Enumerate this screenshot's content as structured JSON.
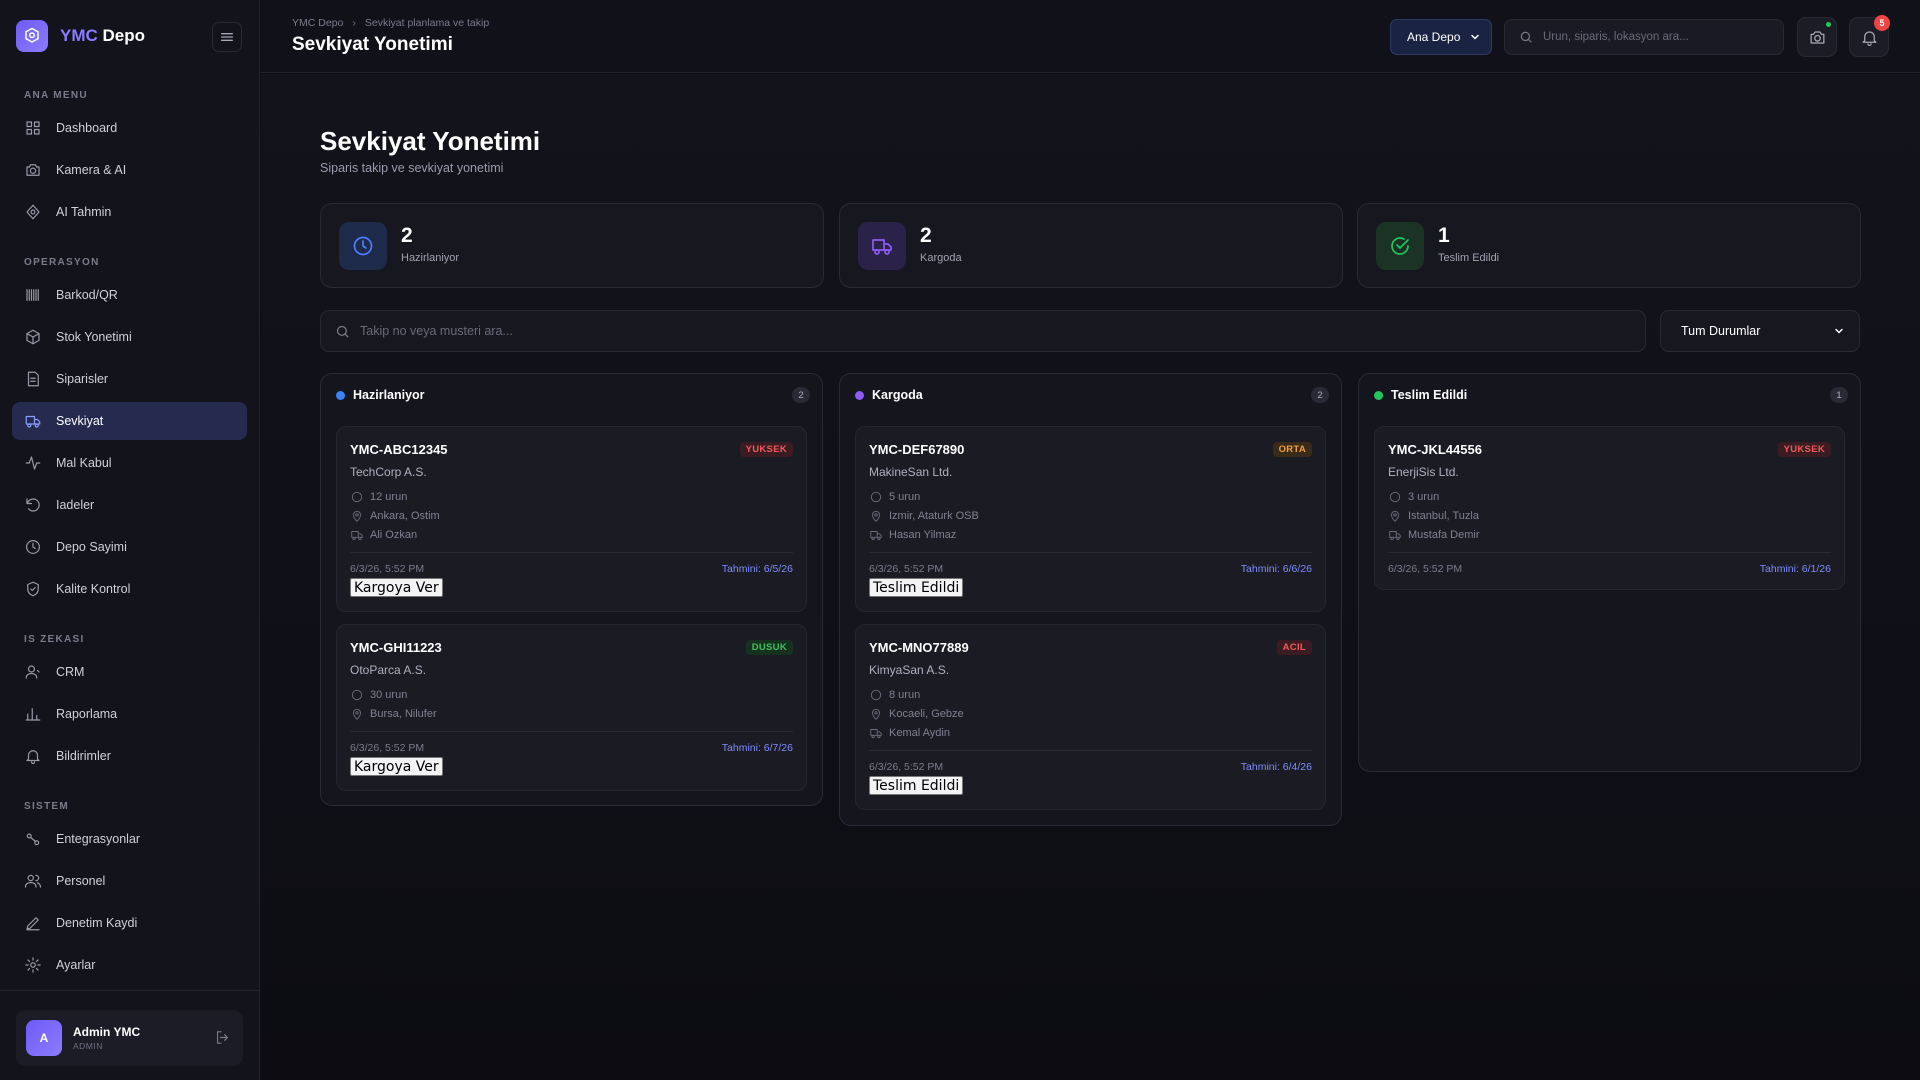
{
  "brand": {
    "prefix": "YMC",
    "name": "Depo"
  },
  "sidebar": {
    "sections": [
      "ANA MENU",
      "OPERASYON",
      "IS ZEKASI",
      "SISTEM"
    ],
    "items": [
      {
        "label": "Dashboard",
        "icon": "grid-icon"
      },
      {
        "label": "Kamera & AI",
        "icon": "camera-icon"
      },
      {
        "label": "AI Tahmin",
        "icon": "ai-icon"
      },
      {
        "label": "Barkod/QR",
        "icon": "barcode-icon"
      },
      {
        "label": "Stok Yonetimi",
        "icon": "box-icon"
      },
      {
        "label": "Siparisler",
        "icon": "document-icon"
      },
      {
        "label": "Sevkiyat",
        "icon": "truck-icon",
        "active": true
      },
      {
        "label": "Mal Kabul",
        "icon": "activity-icon"
      },
      {
        "label": "Iadeler",
        "icon": "undo-icon"
      },
      {
        "label": "Depo Sayimi",
        "icon": "clock-icon"
      },
      {
        "label": "Kalite Kontrol",
        "icon": "shield-icon"
      },
      {
        "label": "CRM",
        "icon": "user-icon"
      },
      {
        "label": "Raporlama",
        "icon": "bar-chart-icon"
      },
      {
        "label": "Bildirimler",
        "icon": "bell-icon"
      },
      {
        "label": "Entegrasyonlar",
        "icon": "integration-icon"
      },
      {
        "label": "Personel",
        "icon": "users-icon"
      },
      {
        "label": "Denetim Kaydi",
        "icon": "pen-icon"
      },
      {
        "label": "Ayarlar",
        "icon": "gear-icon"
      }
    ]
  },
  "user": {
    "initial": "A",
    "name": "Admin YMC",
    "role": "ADMIN"
  },
  "topbar": {
    "breadcrumb": [
      "YMC Depo",
      "Sevkiyat planlama ve takip"
    ],
    "title": "Sevkiyat Yonetimi",
    "warehouse": "Ana Depo",
    "search_placeholder": "Urun, siparis, lokasyon ara...",
    "notification_count": "5"
  },
  "page": {
    "title": "Sevkiyat Yonetimi",
    "subtitle": "Siparis takip ve sevkiyat yonetimi",
    "search_placeholder": "Takip no veya musteri ara...",
    "status_filter": "Tum Durumlar"
  },
  "stats": [
    {
      "value": "2",
      "label": "Hazirlaniyor",
      "color": "#4f7cff"
    },
    {
      "value": "2",
      "label": "Kargoda",
      "color": "#8b5cf6"
    },
    {
      "value": "1",
      "label": "Teslim Edildi",
      "color": "#22c55e"
    }
  ],
  "columns": [
    {
      "title": "Hazirlaniyor",
      "count": "2",
      "color": "#3b82f6",
      "cards": [
        {
          "id": "YMC-ABC12345",
          "customer": "TechCorp A.S.",
          "priority": "YUKSEK",
          "items": "12 urun",
          "location": "Ankara, Ostim",
          "courier": "Ali Ozkan",
          "date": "6/3/26, 5:52 PM",
          "eta": "Tahmini: 6/5/26",
          "action": "Kargoya Ver"
        },
        {
          "id": "YMC-GHI11223",
          "customer": "OtoParca A.S.",
          "priority": "DUSUK",
          "items": "30 urun",
          "location": "Bursa, Nilufer",
          "courier": "",
          "date": "6/3/26, 5:52 PM",
          "eta": "Tahmini: 6/7/26",
          "action": "Kargoya Ver"
        }
      ]
    },
    {
      "title": "Kargoda",
      "count": "2",
      "color": "#8b5cf6",
      "cards": [
        {
          "id": "YMC-DEF67890",
          "customer": "MakineSan Ltd.",
          "priority": "ORTA",
          "items": "5 urun",
          "location": "Izmir, Ataturk OSB",
          "courier": "Hasan Yilmaz",
          "date": "6/3/26, 5:52 PM",
          "eta": "Tahmini: 6/6/26",
          "action": "Teslim Edildi"
        },
        {
          "id": "YMC-MNO77889",
          "customer": "KimyaSan A.S.",
          "priority": "ACIL",
          "items": "8 urun",
          "location": "Kocaeli, Gebze",
          "courier": "Kemal Aydin",
          "date": "6/3/26, 5:52 PM",
          "eta": "Tahmini: 6/4/26",
          "action": "Teslim Edildi"
        }
      ]
    },
    {
      "title": "Teslim Edildi",
      "count": "1",
      "color": "#22c55e",
      "cards": [
        {
          "id": "YMC-JKL44556",
          "customer": "EnerjiSis Ltd.",
          "priority": "YUKSEK",
          "items": "3 urun",
          "location": "Istanbul, Tuzla",
          "courier": "Mustafa Demir",
          "date": "6/3/26, 5:52 PM",
          "eta": "Tahmini: 6/1/26",
          "action": ""
        }
      ]
    }
  ]
}
